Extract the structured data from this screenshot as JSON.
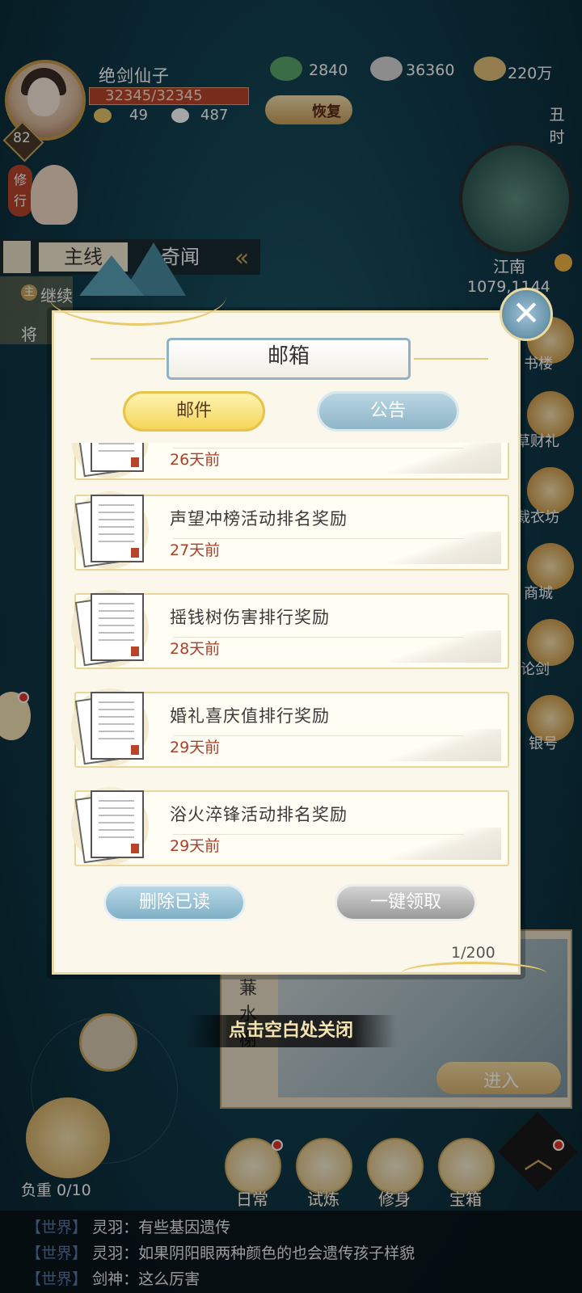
{
  "hud": {
    "player_name": "绝剑仙子",
    "level": "82",
    "hp": "32345/32345",
    "stat_a": "49",
    "stat_b": "487",
    "res_jade": "2840",
    "res_silver": "36360",
    "res_gold": "220万",
    "restore_label": "恢复",
    "time_badge": "丑时",
    "cultivate_badge": "修行",
    "region": "江南",
    "coords": "1079,1144"
  },
  "quest": {
    "tab_main": "主线",
    "tab_tales": "奇闻",
    "tag": "主",
    "line1": "继续",
    "line2": "将"
  },
  "side_menu": [
    {
      "label": "书楼"
    },
    {
      "label": "草财礼"
    },
    {
      "label": "裁衣坊"
    },
    {
      "label": "商城"
    },
    {
      "label": "论剑"
    },
    {
      "label": "银号"
    }
  ],
  "dialog": {
    "title": "邮箱",
    "tab_mail": "邮件",
    "tab_notice": "公告",
    "items": [
      {
        "title": "",
        "date": "26天前"
      },
      {
        "title": "声望冲榜活动排名奖励",
        "date": "27天前"
      },
      {
        "title": "摇钱树伤害排行奖励",
        "date": "28天前"
      },
      {
        "title": "婚礼喜庆值排行奖励",
        "date": "29天前"
      },
      {
        "title": "浴火淬锋活动排名奖励",
        "date": "29天前"
      }
    ],
    "delete_read_label": "删除已读",
    "claim_all_label": "一键领取",
    "count": "1/200",
    "close_hint": "点击空白处关闭"
  },
  "city": {
    "name": "蒹水榭",
    "enter_label": "进入"
  },
  "bottom": {
    "load_label": "负重 0/10",
    "buttons": [
      {
        "label": "日常"
      },
      {
        "label": "试炼"
      },
      {
        "label": "修身"
      },
      {
        "label": "宝箱"
      }
    ]
  },
  "chat": [
    {
      "channel": "【世界】",
      "text": "灵羽：有些基因遗传"
    },
    {
      "channel": "【世界】",
      "text": "灵羽：如果阴阳眼两种颜色的也会遗传孩子样貌"
    },
    {
      "channel": "【世界】",
      "text": "剑神：这么厉害"
    }
  ],
  "colors": {
    "accent_gold": "#e8c24a",
    "date_red": "#a8402a",
    "notice_blue": "#8fb6c8"
  }
}
